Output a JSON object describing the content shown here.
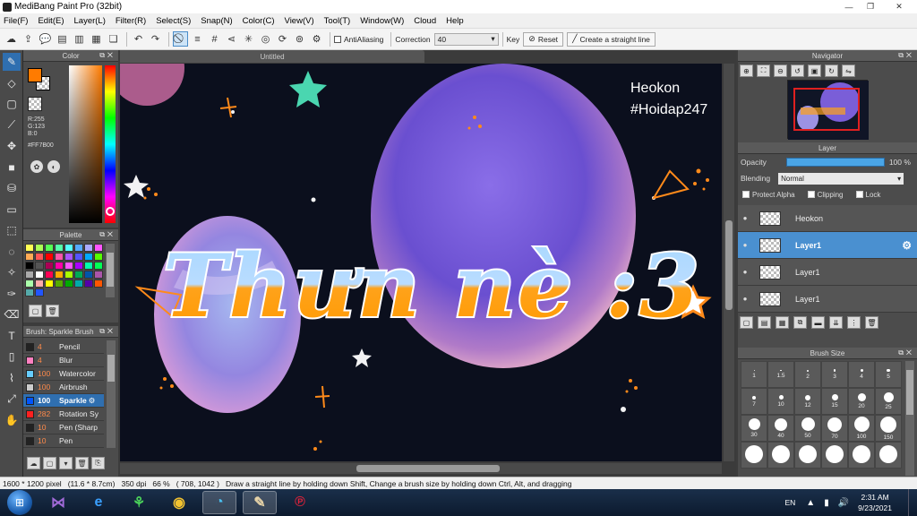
{
  "window": {
    "title": "MediBang Paint Pro (32bit)",
    "controls": [
      "—",
      "❐",
      "✕"
    ]
  },
  "menu": [
    "File(F)",
    "Edit(E)",
    "Layer(L)",
    "Filter(R)",
    "Select(S)",
    "Snap(N)",
    "Color(C)",
    "View(V)",
    "Tool(T)",
    "Window(W)",
    "Cloud",
    "Help"
  ],
  "toolbar": {
    "antialiasing_label": "AntiAliasing",
    "correction_label": "Correction",
    "correction_value": "40",
    "key_label": "Key",
    "reset_label": "Reset",
    "straight_line_label": "Create a straight line"
  },
  "color_panel": {
    "title": "Color",
    "foreground": "#FF7B00",
    "r": "R:255",
    "g": "G:123",
    "b": "B:0",
    "hex": "#FF7B00"
  },
  "palette_panel": {
    "title": "Palette",
    "colors": [
      "#ffff55",
      "#aaff55",
      "#55ff55",
      "#55ffaa",
      "#55ffff",
      "#55aaff",
      "#aaaaff",
      "#ff55ff",
      "#ffaa55",
      "#ff5555",
      "#ff0000",
      "#ff55aa",
      "#aa55ff",
      "#5555ff",
      "#00aaff",
      "#55ff00",
      "#000000",
      "#555555",
      "#aa0055",
      "#ff00aa",
      "#ff55ff",
      "#aa00ff",
      "#00ffaa",
      "#00ff55",
      "#aaaaaa",
      "#ffffff",
      "#ff0055",
      "#ffaa00",
      "#aaff00",
      "#00aa55",
      "#0055aa",
      "#aa55aa",
      "#aaffaa",
      "#ffaaaa",
      "#ffff00",
      "#55aa00",
      "#00aa00",
      "#00aaaa",
      "#5500aa",
      "#ff5500",
      "#55aaaa",
      "#2255ff"
    ]
  },
  "brush_panel": {
    "title": "Brush: Sparkle Brush",
    "brushes": [
      {
        "size": "4",
        "name": "Pencil",
        "color": "#222222"
      },
      {
        "size": "4",
        "name": "Blur",
        "color": "#ff80c0"
      },
      {
        "size": "100",
        "name": "Watercolor",
        "color": "#66ccff"
      },
      {
        "size": "100",
        "name": "Airbrush",
        "color": "#cccccc"
      },
      {
        "size": "100",
        "name": "Sparkle",
        "color": "#0055ff"
      },
      {
        "size": "282",
        "name": "Rotation Sy",
        "color": "#ff2020"
      },
      {
        "size": "10",
        "name": "Pen (Sharp",
        "color": "#222222"
      },
      {
        "size": "10",
        "name": "Pen",
        "color": "#222222"
      }
    ]
  },
  "document": {
    "tab_title": "Untitled",
    "watermark_line1": "Heokon",
    "watermark_line2": "#Hoidap247",
    "lettering": "Thưn nè :3"
  },
  "navigator": {
    "title": "Navigator"
  },
  "layer_panel": {
    "title": "Layer",
    "opacity_label": "Opacity",
    "opacity_value": "100 %",
    "opacity": 1.0,
    "blending_label": "Blending",
    "blending_value": "Normal",
    "protect_alpha": "Protect Alpha",
    "clipping": "Clipping",
    "lock": "Lock",
    "layers": [
      {
        "name": "Heokon",
        "selected": false
      },
      {
        "name": "Layer1",
        "selected": true
      },
      {
        "name": "Layer1",
        "selected": false
      },
      {
        "name": "Layer1",
        "selected": false
      }
    ]
  },
  "brush_size_panel": {
    "title": "Brush Size",
    "sizes": [
      "1",
      "1.5",
      "2",
      "3",
      "4",
      "5",
      "7",
      "10",
      "12",
      "15",
      "20",
      "25",
      "30",
      "40",
      "50",
      "70",
      "100",
      "150"
    ]
  },
  "status": {
    "dims": "1600 * 1200 pixel",
    "cm": "(11.6 * 8.7cm)",
    "dpi": "350 dpi",
    "zoom": "66 %",
    "coords": "( 708, 1042 )",
    "hint": "Draw a straight line by holding down Shift, Change a brush size by holding down Ctrl, Alt, and dragging"
  },
  "taskbar": {
    "lang": "EN",
    "time": "2:31 AM",
    "date": "9/23/2021"
  }
}
